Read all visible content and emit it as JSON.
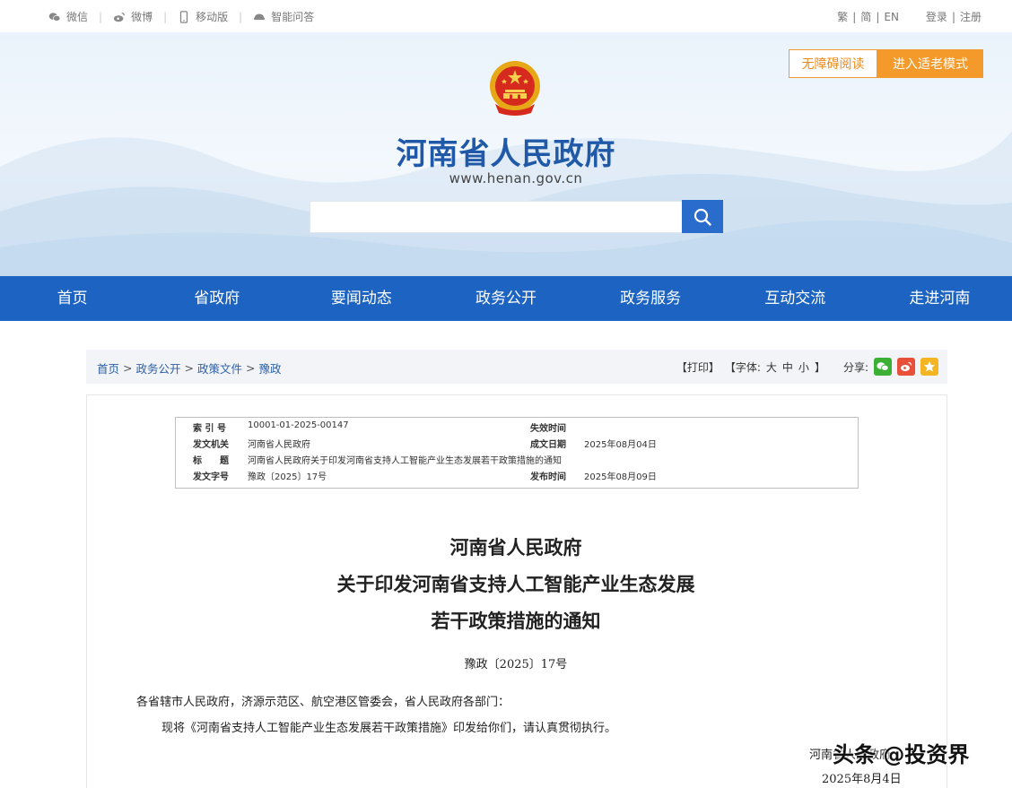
{
  "topbar": {
    "links": [
      {
        "label": "微信",
        "icon": "wechat-icon"
      },
      {
        "label": "微博",
        "icon": "weibo-icon"
      },
      {
        "label": "移动版",
        "icon": "mobile-icon"
      },
      {
        "label": "智能问答",
        "icon": "chat-robot-icon"
      }
    ],
    "lang_trad": "繁",
    "lang_simp": "简",
    "lang_en": "EN",
    "login": "登录",
    "register": "注册",
    "pipe": "|"
  },
  "header": {
    "title": "河南省人民政府",
    "url": "www.henan.gov.cn",
    "search": {
      "value": "",
      "placeholder": ""
    },
    "accessible_label": "无障碍阅读",
    "elder_label": "进入适老模式"
  },
  "nav": {
    "items": [
      "首页",
      "省政府",
      "要闻动态",
      "政务公开",
      "政务服务",
      "互动交流",
      "走进河南"
    ]
  },
  "breadcrumb": {
    "items": [
      "首页",
      "政务公开",
      "政策文件",
      "豫政"
    ],
    "separator": ">"
  },
  "tools": {
    "print": "【打印】",
    "font_prefix": "【字体:",
    "font_large": "大",
    "font_medium": "中",
    "font_small": "小",
    "font_suffix": "】",
    "share_label": "分享:"
  },
  "meta": {
    "index_label": "索 引 号",
    "index_value": "10001-01-2025-00147",
    "expire_label": "失效时间",
    "expire_value": "",
    "issuer_label": "发文机关",
    "issuer_value": "河南省人民政府",
    "created_label": "成文日期",
    "created_value": "2025年08月04日",
    "title_label": "标　　题",
    "title_value": "河南省人民政府关于印发河南省支持人工智能产业生态发展若干政策措施的通知",
    "docno_label": "发文字号",
    "docno_value": "豫政〔2025〕17号",
    "publish_label": "发布时间",
    "publish_value": "2025年08月09日"
  },
  "document": {
    "title_line1": "河南省人民政府",
    "title_line2": "关于印发河南省支持人工智能产业生态发展",
    "title_line3": "若干政策措施的通知",
    "number": "豫政〔2025〕17号",
    "salutation": "各省辖市人民政府，济源示范区、航空港区管委会，省人民政府各部门：",
    "body": "现将《河南省支持人工智能产业生态发展若干政策措施》印发给你们，请认真贯彻执行。",
    "sign_org": "河南省人民政府",
    "sign_date": "2025年8月4日"
  },
  "watermark": "头条 @投资界",
  "colors": {
    "brand_blue": "#1d64c2",
    "title_blue": "#1f59a8",
    "accent_orange": "#f39a2b"
  }
}
